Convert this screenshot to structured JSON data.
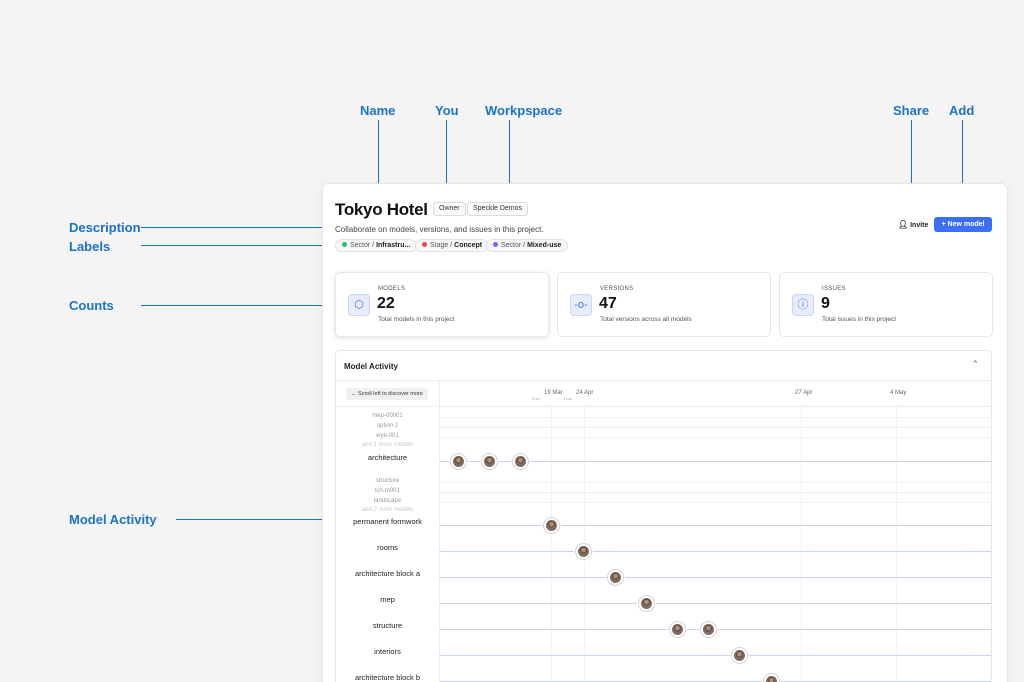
{
  "annotations": {
    "name": "Name",
    "you": "You",
    "workspace": "Workpspace",
    "share": "Share",
    "add": "Add",
    "description": "Description",
    "labels": "Labels",
    "counts": "Counts",
    "model_activity": "Model Activity"
  },
  "project": {
    "title": "Tokyo Hotel",
    "role_chip": "Owner",
    "workspace_chip": "Speckle Demos",
    "description": "Collaborate on models, versions, and issues in this project.",
    "labels": [
      {
        "prefix": "Sector /",
        "value": "Infrastru...",
        "color": "#22c55e"
      },
      {
        "prefix": "Stage /",
        "value": "Concept",
        "color": "#ef4444"
      },
      {
        "prefix": "Sector /",
        "value": "Mixed-use",
        "color": "#8b5cf6"
      }
    ],
    "invite_label": "Invite",
    "new_model_label": "+ New model"
  },
  "counts": [
    {
      "label": "MODELS",
      "value": "22",
      "sub": "Total models in this project",
      "icon": "cube-icon"
    },
    {
      "label": "VERSIONS",
      "value": "47",
      "sub": "Total versions across all models",
      "icon": "commit-icon"
    },
    {
      "label": "ISSUES",
      "value": "9",
      "sub": "Total issues in this project",
      "icon": "info-icon"
    }
  ],
  "activity": {
    "title": "Model Activity",
    "scroll_hint": "← Scroll left to discover more",
    "dates": [
      "19 Mar",
      "24 Apr",
      "27 Apr",
      "4 May"
    ],
    "sub_dates": [
      "2 en",
      "1 mo"
    ],
    "group1_faint": [
      "mep-00001",
      "option 2",
      "wye-001"
    ],
    "group1_more": "and 1 more models",
    "group1_main": "architecture",
    "group2_faint": [
      "structure",
      "lch-m001",
      "landscape"
    ],
    "group2_more": "and 2 more models",
    "rows": [
      "permanent formwork",
      "rooms",
      "architecture block a",
      "mep",
      "structure",
      "interiors",
      "architecture block b"
    ]
  }
}
